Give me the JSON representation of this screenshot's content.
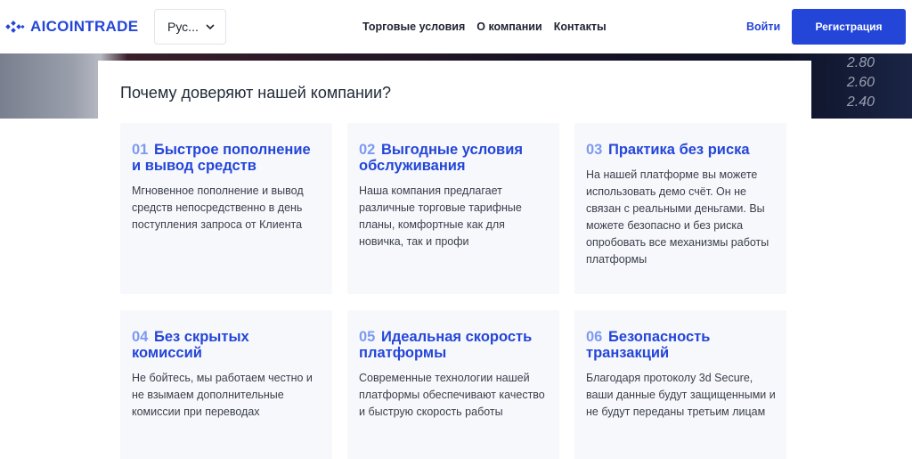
{
  "header": {
    "brand": "AICOINTRADE",
    "language": "Рус...",
    "nav": [
      "Торговые условия",
      "О компании",
      "Контакты"
    ],
    "login": "Войти",
    "register": "Регистрация"
  },
  "hero": {
    "ticks": [
      "2.80",
      "2.60",
      "2.40"
    ]
  },
  "section": {
    "title": "Почему доверяют нашей компании?",
    "features": [
      {
        "num": "01",
        "title": "Быстрое пополнение и вывод средств",
        "text": "Мгновенное пополнение и вывод средств непосредственно в день поступления запроса от Клиента"
      },
      {
        "num": "02",
        "title": "Выгодные условия обслуживания",
        "text": "Наша компания предлагает различные торговые тарифные планы, комфортные как для новичка, так и профи"
      },
      {
        "num": "03",
        "title": "Практика без риска",
        "text": "На нашей платформе вы можете использовать демо счёт. Он не связан с реальными деньгами. Вы можете безопасно и без риска опробовать все механизмы работы платформы"
      },
      {
        "num": "04",
        "title": "Без скрытых комиссий",
        "text": "Не бойтесь, мы работаем честно и не взымаем дополнительные комиссии при переводах"
      },
      {
        "num": "05",
        "title": "Идеальная скорость платформы",
        "text": "Современные технологии нашей платформы обеспечивают качество и быструю скорость работы"
      },
      {
        "num": "06",
        "title": "Безопасность транзакций",
        "text": "Благодаря протоколу 3d Secure, ваши данные будут защищенными и не будут переданы третьим лицам"
      }
    ]
  },
  "colors": {
    "accent": "#2446d8",
    "number": "#7d9af0",
    "card_bg": "#f7f8fc"
  }
}
